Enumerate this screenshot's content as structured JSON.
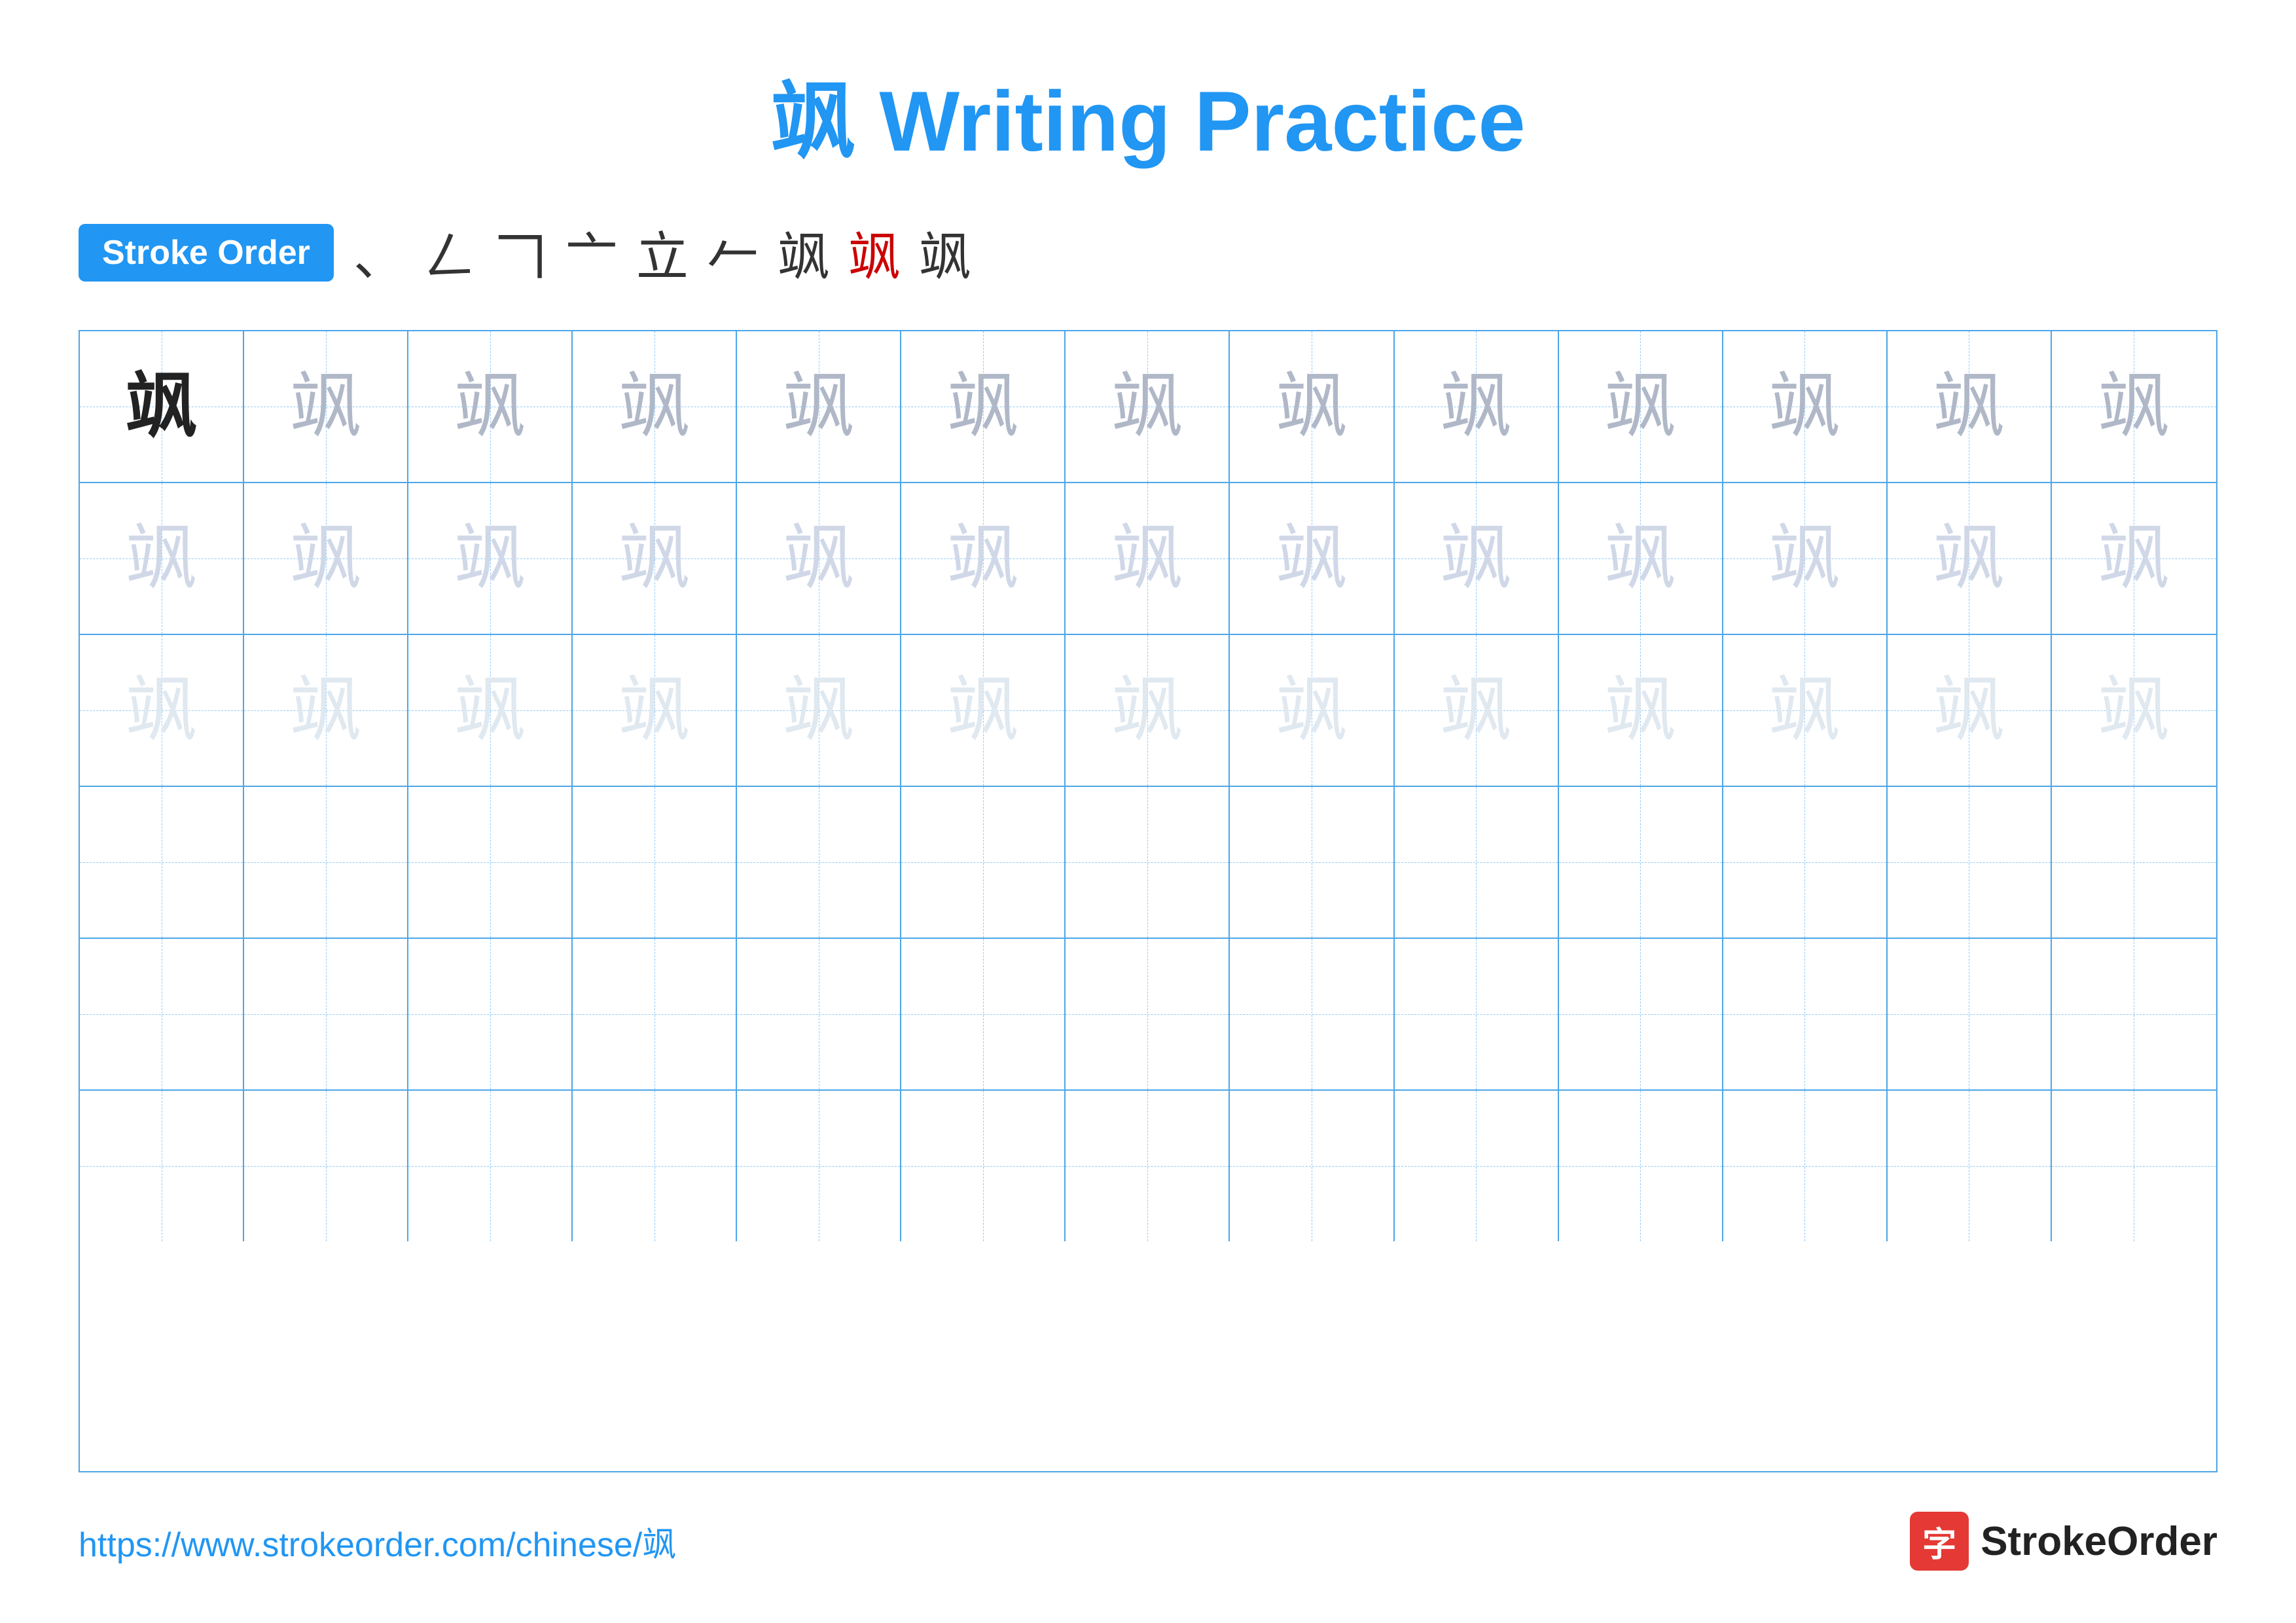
{
  "title": {
    "char": "飒",
    "text": " Writing Practice"
  },
  "stroke_order": {
    "badge_label": "Stroke Order",
    "strokes": [
      "、",
      "⺃",
      "𠃍",
      "⺁",
      "立",
      "𠂉",
      "飒",
      "飒",
      "飒"
    ]
  },
  "grid": {
    "char": "飒",
    "rows": 6,
    "cols": 13
  },
  "footer": {
    "url": "https://www.strokeorder.com/chinese/飒",
    "logo_char": "字",
    "logo_text": "StrokeOrder"
  }
}
